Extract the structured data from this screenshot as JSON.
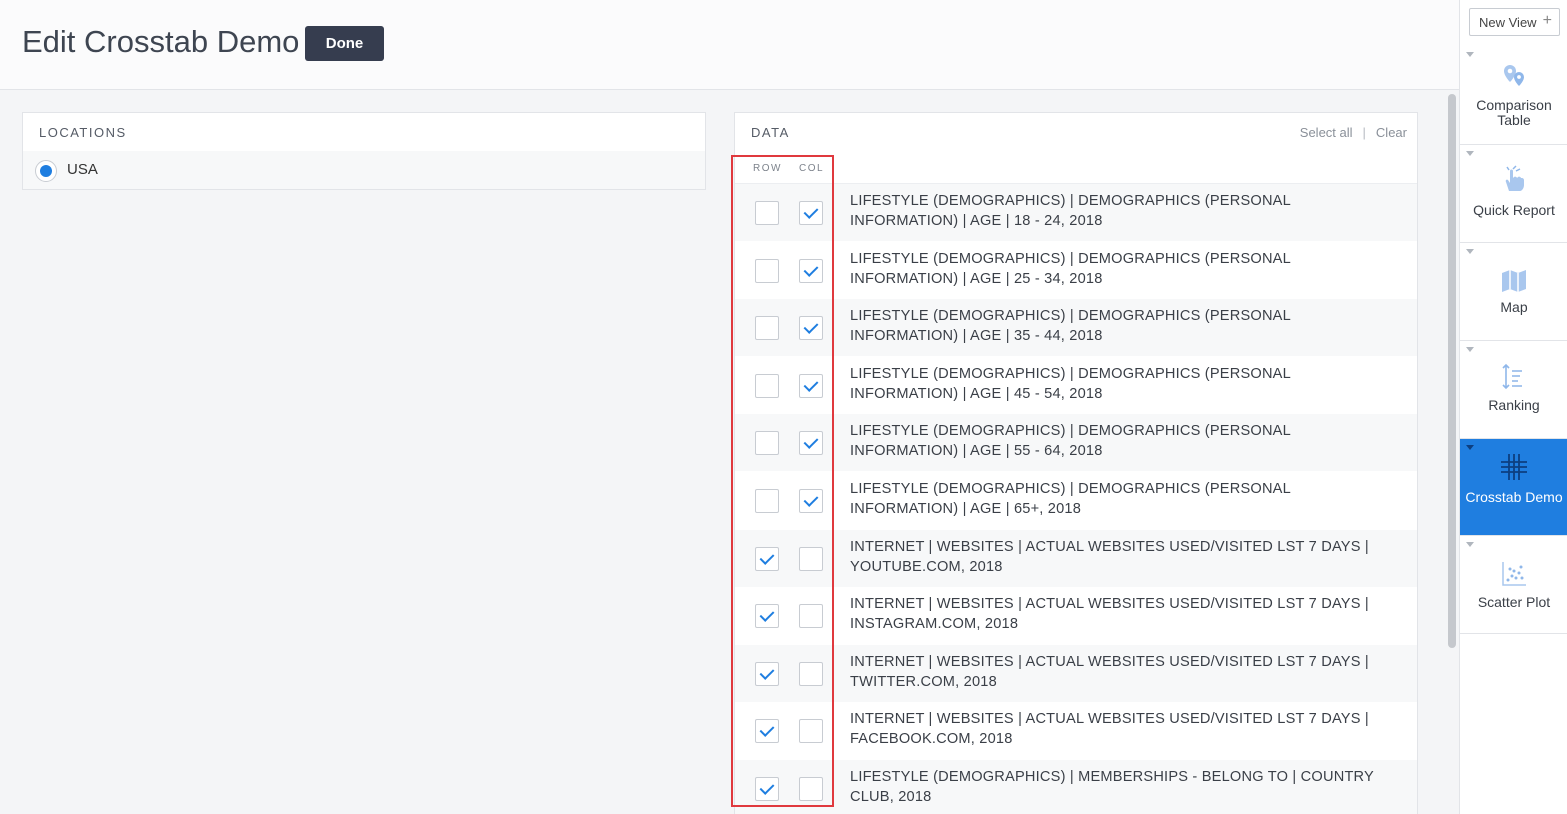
{
  "header": {
    "title": "Edit Crosstab Demo",
    "done_label": "Done"
  },
  "locations": {
    "title": "LOCATIONS",
    "items": [
      {
        "label": "USA",
        "selected": true
      }
    ]
  },
  "data_panel": {
    "title": "DATA",
    "select_all": "Select all",
    "separator": "|",
    "clear": "Clear",
    "row_header": "ROW",
    "col_header": "COL",
    "rows": [
      {
        "label": "LIFESTYLE (DEMOGRAPHICS) | DEMOGRAPHICS (PERSONAL INFORMATION) | AGE | 18 - 24, 2018",
        "row": false,
        "col": true
      },
      {
        "label": "LIFESTYLE (DEMOGRAPHICS) | DEMOGRAPHICS (PERSONAL INFORMATION) | AGE | 25 - 34, 2018",
        "row": false,
        "col": true
      },
      {
        "label": "LIFESTYLE (DEMOGRAPHICS) | DEMOGRAPHICS (PERSONAL INFORMATION) | AGE | 35 - 44, 2018",
        "row": false,
        "col": true
      },
      {
        "label": "LIFESTYLE (DEMOGRAPHICS) | DEMOGRAPHICS (PERSONAL INFORMATION) | AGE | 45 - 54, 2018",
        "row": false,
        "col": true
      },
      {
        "label": "LIFESTYLE (DEMOGRAPHICS) | DEMOGRAPHICS (PERSONAL INFORMATION) | AGE | 55 - 64, 2018",
        "row": false,
        "col": true
      },
      {
        "label": "LIFESTYLE (DEMOGRAPHICS) | DEMOGRAPHICS (PERSONAL INFORMATION) | AGE | 65+, 2018",
        "row": false,
        "col": true
      },
      {
        "label": "INTERNET | WEBSITES | ACTUAL WEBSITES USED/VISITED LST 7 DAYS | YOUTUBE.COM, 2018",
        "row": true,
        "col": false
      },
      {
        "label": "INTERNET | WEBSITES | ACTUAL WEBSITES USED/VISITED LST 7 DAYS | INSTAGRAM.COM, 2018",
        "row": true,
        "col": false
      },
      {
        "label": "INTERNET | WEBSITES | ACTUAL WEBSITES USED/VISITED LST 7 DAYS | TWITTER.COM, 2018",
        "row": true,
        "col": false
      },
      {
        "label": "INTERNET | WEBSITES | ACTUAL WEBSITES USED/VISITED LST 7 DAYS | FACEBOOK.COM, 2018",
        "row": true,
        "col": false
      },
      {
        "label": "LIFESTYLE (DEMOGRAPHICS) | MEMBERSHIPS - BELONG TO | COUNTRY CLUB, 2018",
        "row": true,
        "col": false
      }
    ]
  },
  "sidebar": {
    "new_view": "New View",
    "new_view_icon": "plus-icon",
    "items": [
      {
        "label": "Comparison Table",
        "icon": "comparison-table-icon",
        "active": false
      },
      {
        "label": "Quick Report",
        "icon": "quick-report-icon",
        "active": false
      },
      {
        "label": "Map",
        "icon": "map-icon",
        "active": false
      },
      {
        "label": "Ranking",
        "icon": "ranking-icon",
        "active": false
      },
      {
        "label": "Crosstab Demo",
        "icon": "crosstab-icon",
        "active": true
      },
      {
        "label": "Scatter Plot",
        "icon": "scatter-plot-icon",
        "active": false
      }
    ]
  },
  "colors": {
    "accent": "#1f7ee0",
    "done_button": "#363d4f",
    "highlight_box": "#e0393e"
  }
}
